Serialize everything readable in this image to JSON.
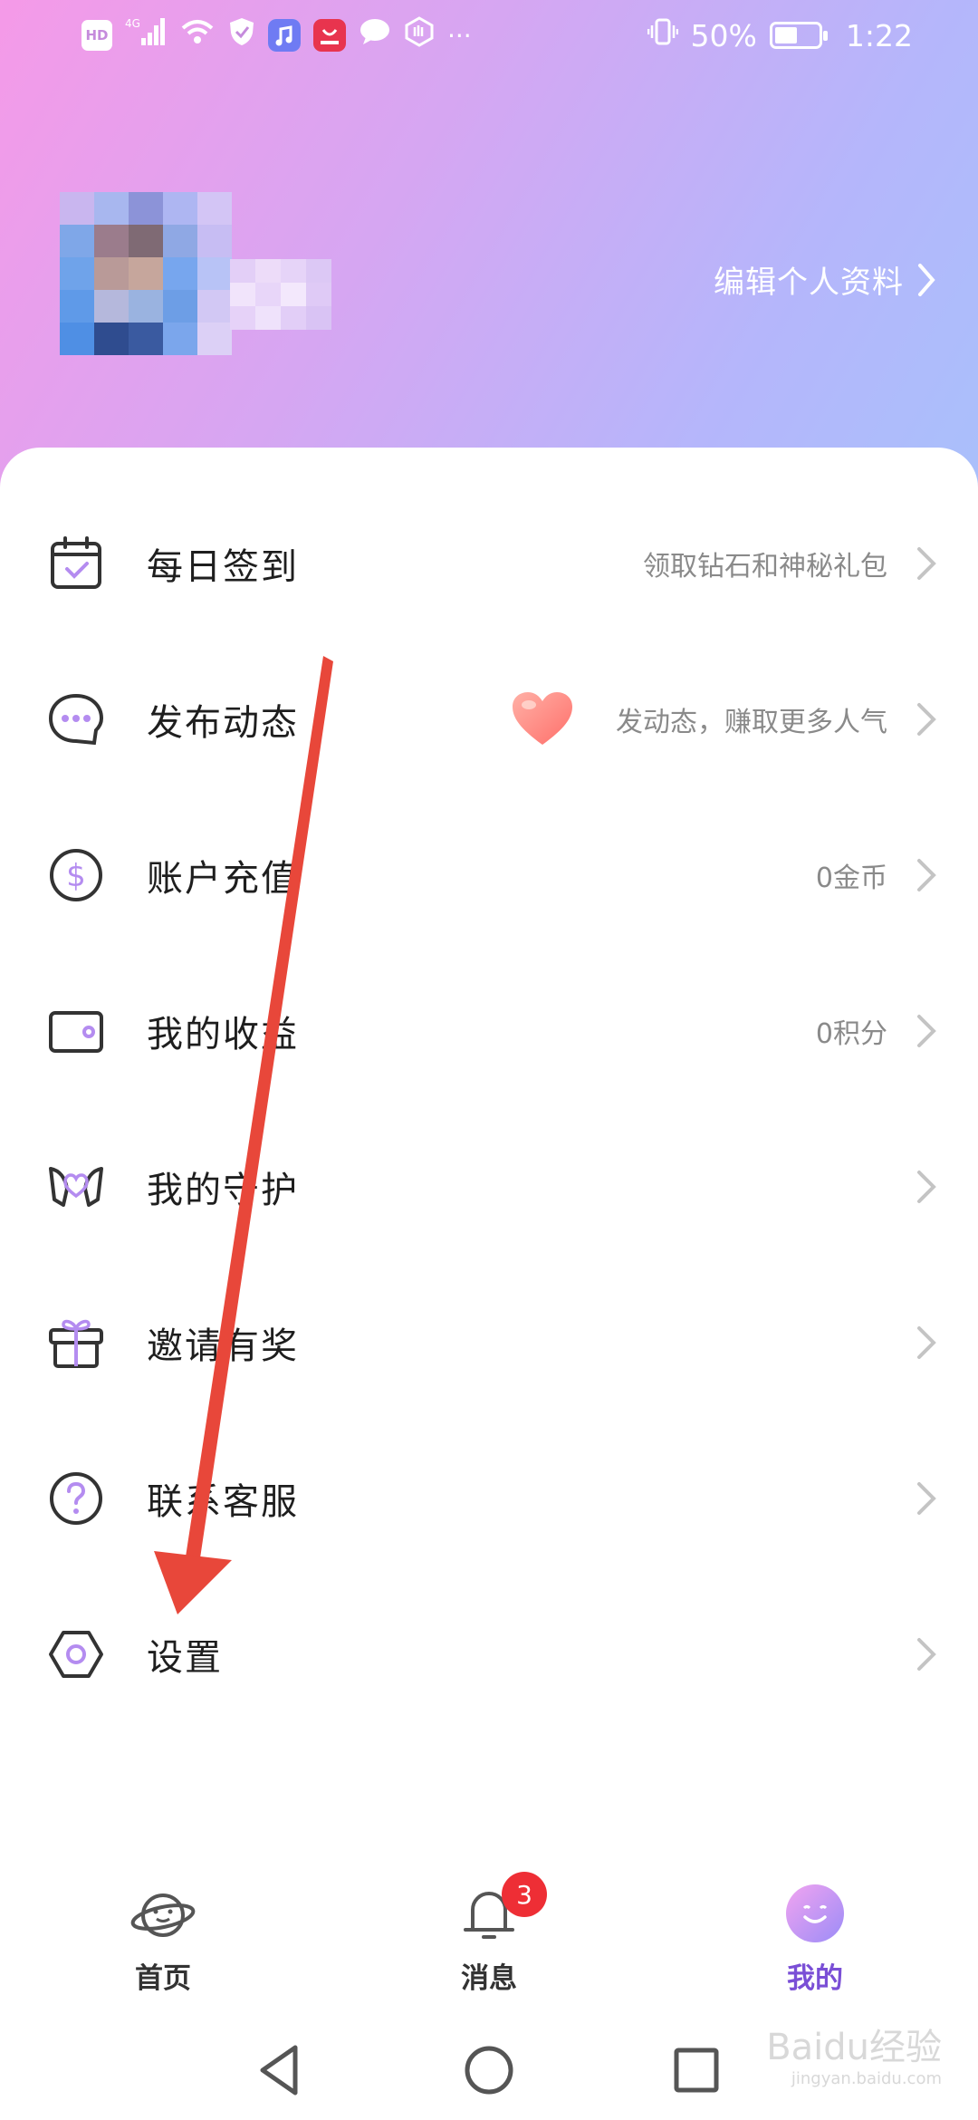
{
  "status_bar": {
    "left_chips": [
      "HD",
      "4G"
    ],
    "battery_percent": "50%",
    "time": "1:22",
    "more": "···"
  },
  "profile": {
    "edit_label": "编辑个人资料"
  },
  "menu": [
    {
      "label": "每日签到",
      "value": "领取钻石和神秘礼包",
      "icon": "calendar-check-icon"
    },
    {
      "label": "发布动态",
      "value": "发动态，赚取更多人气",
      "icon": "chat-bubble-icon"
    },
    {
      "label": "账户充值",
      "value": "0金币",
      "icon": "coin-dollar-icon"
    },
    {
      "label": "我的收益",
      "value": "0积分",
      "icon": "wallet-icon"
    },
    {
      "label": "我的守护",
      "value": "",
      "icon": "angel-heart-icon"
    },
    {
      "label": "邀请有奖",
      "value": "",
      "icon": "gift-icon"
    },
    {
      "label": "联系客服",
      "value": "",
      "icon": "help-icon"
    },
    {
      "label": "设置",
      "value": "",
      "icon": "settings-hexagon-icon"
    }
  ],
  "tabs": [
    {
      "label": "首页",
      "icon": "planet-icon"
    },
    {
      "label": "消息",
      "icon": "bell-icon",
      "badge": "3"
    },
    {
      "label": "我的",
      "icon": "smile-icon",
      "active": true
    }
  ],
  "watermark": {
    "brand": "Baidu经验",
    "url": "jingyan.baidu.com"
  },
  "colors": {
    "accent": "#7a4fd6",
    "badge": "#ee2e35",
    "annotation_arrow": "#e8473a"
  }
}
